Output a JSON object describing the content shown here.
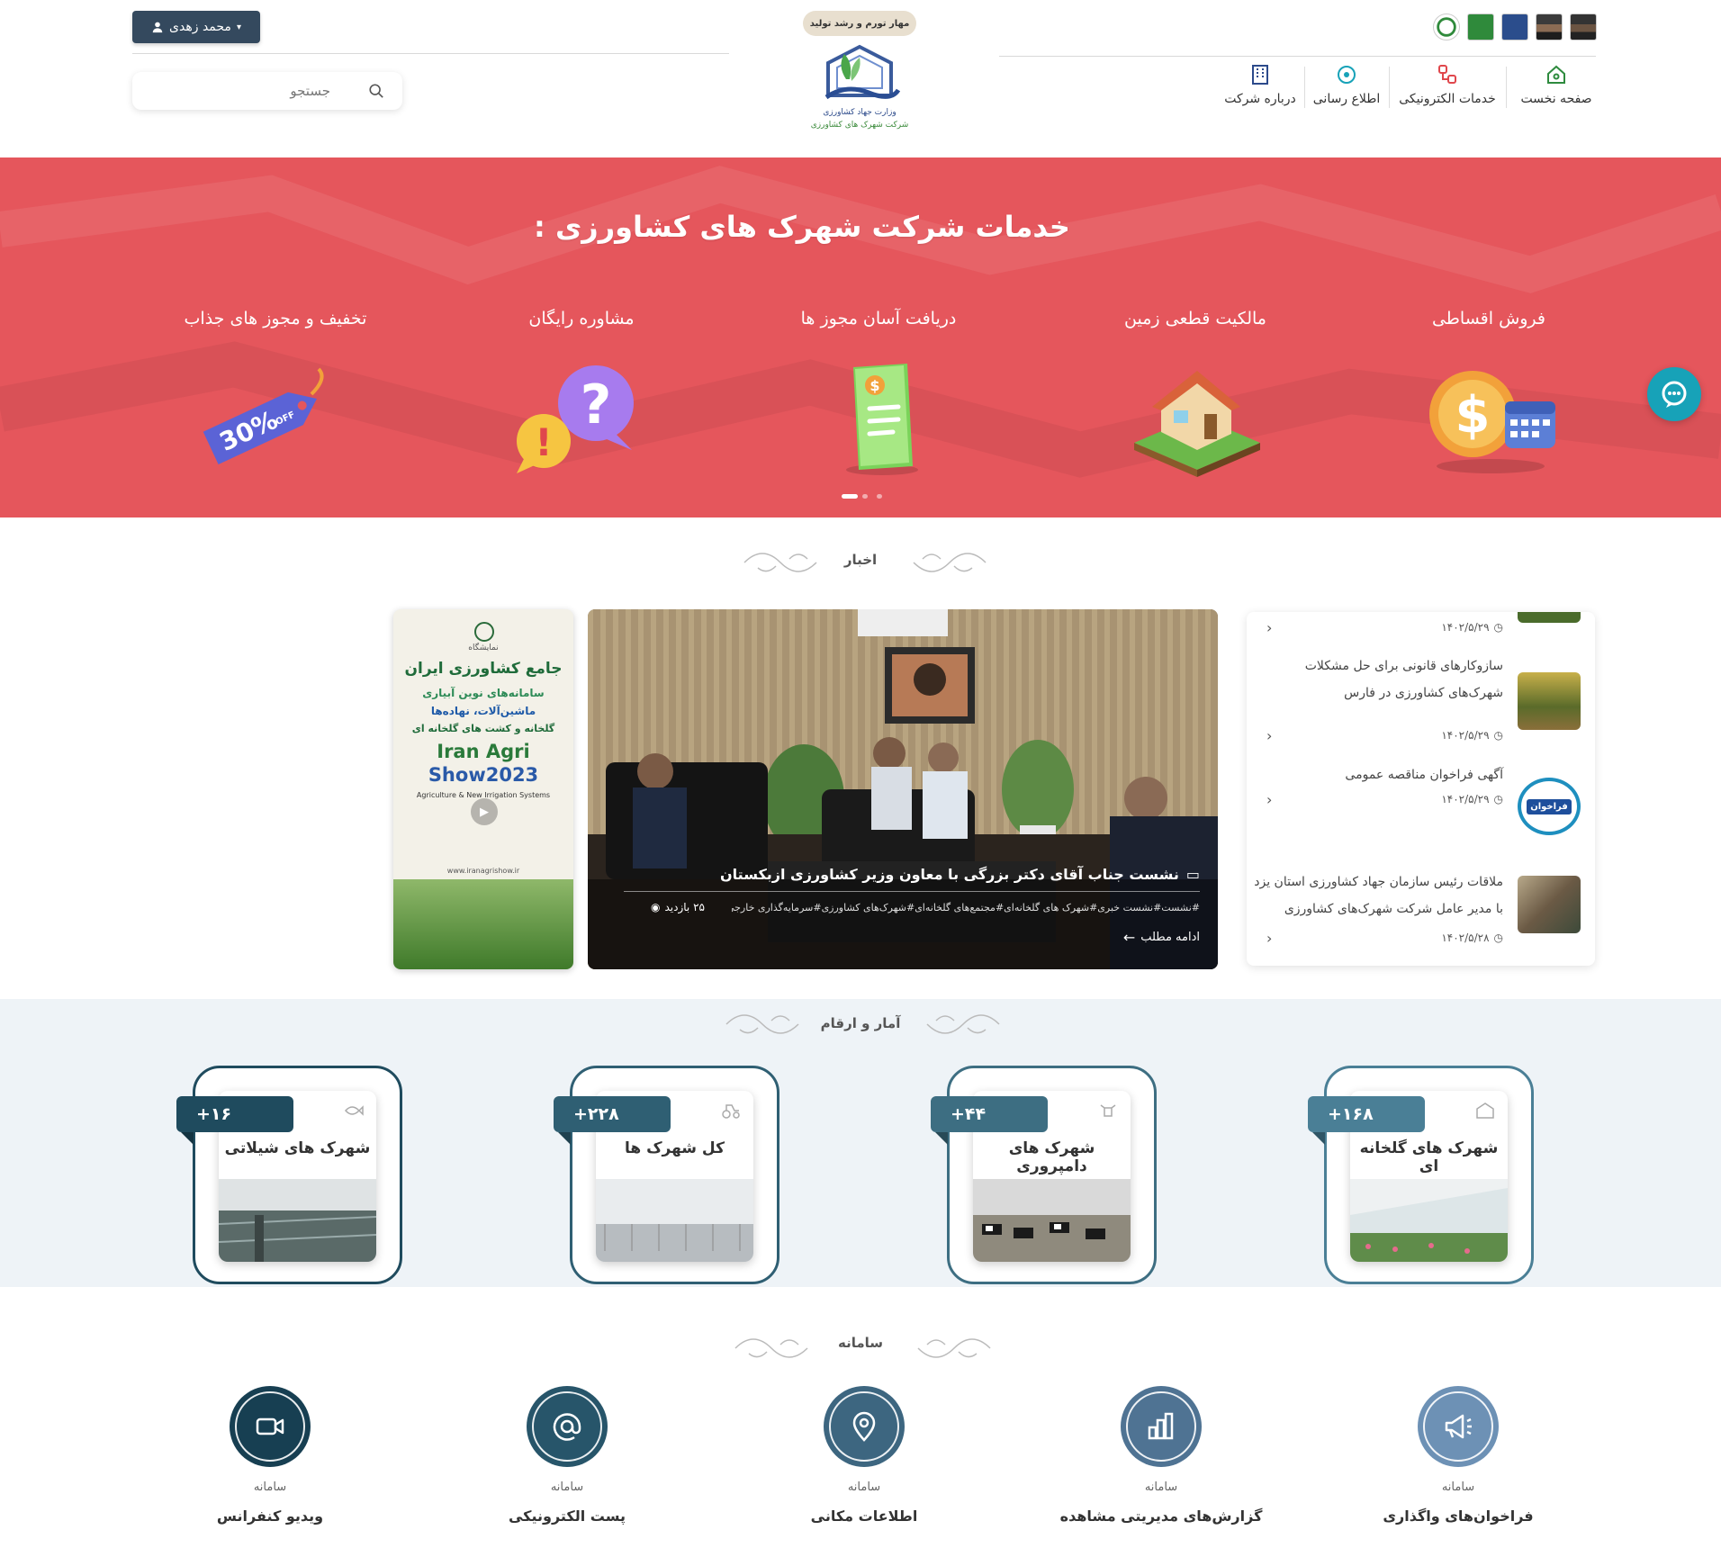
{
  "header": {
    "user_name": "محمد زهدی",
    "search_placeholder": "جستجو",
    "slogan": "مهار تورم و رشد تولید",
    "logo_caption_ministry": "وزارت جهاد کشاورزی",
    "logo_caption_company": "شرکت شهرک های کشاورزی",
    "nav": [
      {
        "label": "صفحه نخست",
        "icon": "home-icon"
      },
      {
        "label": "خدمات الکترونیکی",
        "icon": "e-services-icon"
      },
      {
        "label": "اطلاع رسانی",
        "icon": "broadcast-icon"
      },
      {
        "label": "درباره شرکت",
        "icon": "building-icon"
      }
    ]
  },
  "banner": {
    "title": "خدمات شرکت شهرک های کشاورزی :",
    "services": [
      {
        "label": "فروش اقساطی",
        "icon": "installment-coin-icon"
      },
      {
        "label": "مالکیت قطعی زمین",
        "icon": "house-land-icon"
      },
      {
        "label": "دریافت آسان مجوز ها",
        "icon": "permit-document-icon"
      },
      {
        "label": "مشاوره رایگان",
        "icon": "question-bubble-icon"
      },
      {
        "label": "تخفیف و مجوز های جذاب",
        "icon": "discount-tag-icon"
      }
    ],
    "discount_tag_text": "30%",
    "discount_tag_off": "OFF"
  },
  "news": {
    "section_title": "اخبار",
    "items": [
      {
        "title": "",
        "date": "۱۴۰۲/۵/۲۹"
      },
      {
        "title": "سازوکارهای قانونی برای حل مشکلات شهرک‌های کشاورزی در فارس",
        "date": "۱۴۰۲/۵/۲۹"
      },
      {
        "title": "آگهی فراخوان مناقصه عمومی",
        "date": "۱۴۰۲/۵/۲۹",
        "thumb_text": "فراخوان"
      },
      {
        "title": "ملاقات رئیس سازمان جهاد کشاورزی استان یزد با مدیر عامل شرکت شهرک‌های کشاورزی",
        "date": "۱۴۰۲/۵/۲۸"
      }
    ],
    "featured": {
      "title": "نشست جناب آقای دکتر بزرگی با معاون وزیر کشاورزی ازبکستان",
      "tags": "#نشست#نشست خبری#شهرک های گلخانه‌ای#مجتمع‌های گلخانه‌ای#شهرک‌های کشاورزی#سرمایه‌گذاری خارجی",
      "views": "۲۵ بازدید",
      "read_more": "ادامه مطلب"
    },
    "poster": {
      "heading1": "نمایشگاه",
      "heading2": "جامع کشاورزی ایران",
      "line1": "سامانه‌های نوین آبیاری",
      "line2": "ماشین‌آلات، نهاده‌ها",
      "line3": "گلخانه و کشت های گلخانه ای",
      "brand1": "Iran Agri",
      "brand2": "Show2023",
      "sub": "Agriculture & New Irrigation Systems",
      "website": "www.iranagrishow.ir"
    }
  },
  "stats": {
    "section_title": "آمار و ارقام",
    "items": [
      {
        "count": "+۱۶۸",
        "title": "شهرک های گلخانه ای",
        "icon": "greenhouse-icon",
        "badge_color": "#4a7f96"
      },
      {
        "count": "+۴۴",
        "title": "شهرک های دامپروری",
        "icon": "cow-icon",
        "badge_color": "#3d6e82"
      },
      {
        "count": "+۲۲۸",
        "title": "کل شهرک ها",
        "icon": "tractor-icon",
        "badge_color": "#2f5f73"
      },
      {
        "count": "+۱۶",
        "title": "شهرک های شیلاتی",
        "icon": "fish-icon",
        "badge_color": "#1f4b5e"
      }
    ]
  },
  "systems": {
    "section_title": "سامانه",
    "prefix": "سامانه",
    "items": [
      {
        "name": "فراخوان‌های واگذاری",
        "icon": "megaphone-icon",
        "color": "#6d91b5"
      },
      {
        "name": "گزارش‌های مدیریتی مشاهده",
        "icon": "bar-chart-icon",
        "color": "#4f7393"
      },
      {
        "name": "اطلاعات مکانی",
        "icon": "location-pin-icon",
        "color": "#3d6680"
      },
      {
        "name": "پست الکترونیکی",
        "icon": "at-sign-icon",
        "color": "#27556a"
      },
      {
        "name": "ویدیو کنفرانس",
        "icon": "video-camera-icon",
        "color": "#173f52"
      }
    ]
  }
}
